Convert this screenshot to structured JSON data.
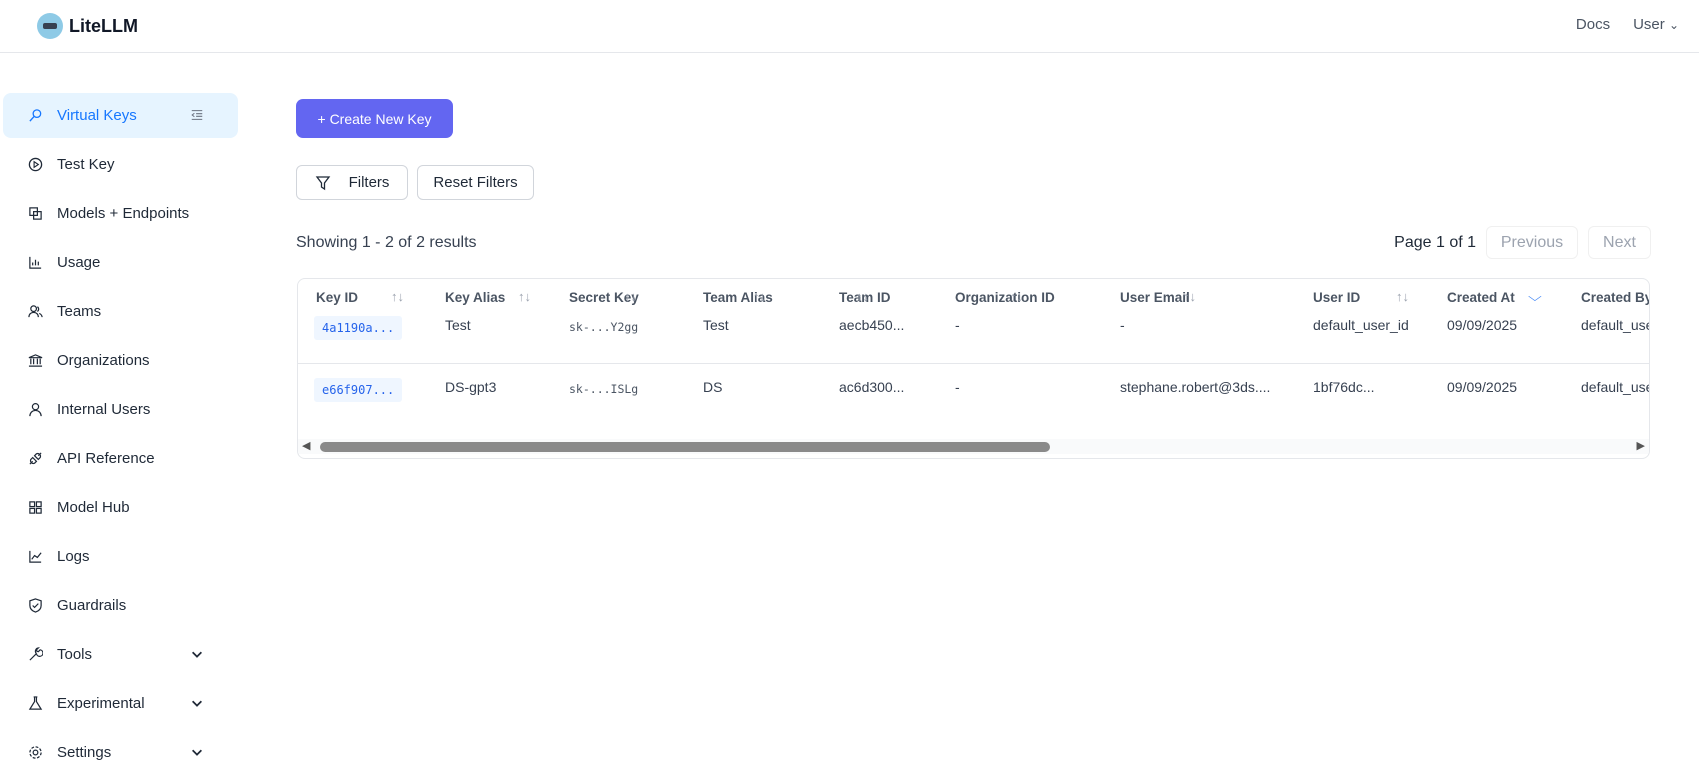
{
  "header": {
    "brand": "LiteLLM",
    "docs": "Docs",
    "user": "User"
  },
  "sidebar": {
    "items": [
      {
        "label": "Virtual Keys",
        "icon": "key-icon",
        "active": true
      },
      {
        "label": "Test Key",
        "icon": "play-circle-icon"
      },
      {
        "label": "Models + Endpoints",
        "icon": "block-icon"
      },
      {
        "label": "Usage",
        "icon": "bar-chart-icon"
      },
      {
        "label": "Teams",
        "icon": "team-icon"
      },
      {
        "label": "Organizations",
        "icon": "bank-icon"
      },
      {
        "label": "Internal Users",
        "icon": "user-icon"
      },
      {
        "label": "API Reference",
        "icon": "api-icon"
      },
      {
        "label": "Model Hub",
        "icon": "apps-icon"
      },
      {
        "label": "Logs",
        "icon": "line-chart-icon"
      },
      {
        "label": "Guardrails",
        "icon": "safety-icon"
      },
      {
        "label": "Tools",
        "icon": "tool-icon",
        "expandable": true
      },
      {
        "label": "Experimental",
        "icon": "experiment-icon",
        "expandable": true
      },
      {
        "label": "Settings",
        "icon": "setting-icon",
        "expandable": true
      }
    ]
  },
  "main": {
    "create_label": "+ Create New Key",
    "filters_label": "Filters",
    "reset_label": "Reset Filters",
    "showing": "Showing 1 - 2 of 2 results",
    "page": "Page 1 of 1",
    "previous": "Previous",
    "next": "Next",
    "accent": "#6366f1"
  },
  "table": {
    "columns": [
      "Key ID",
      "Key Alias",
      "Secret Key",
      "Team Alias",
      "Team ID",
      "Organization ID",
      "User Email",
      "User ID",
      "Created At",
      "Created By"
    ],
    "sorted_column": "Created At",
    "rows": [
      [
        "4a1190a...",
        "Test",
        "sk-...Y2gg",
        "Test",
        "aecb450...",
        "-",
        "-",
        "default_user_id",
        "09/09/2025",
        "default_use"
      ],
      [
        "e66f907...",
        "DS-gpt3",
        "sk-...ISLg",
        "DS",
        "ac6d300...",
        "-",
        "stephane.robert@3ds....",
        "1bf76dc...",
        "09/09/2025",
        "default_use"
      ]
    ]
  }
}
